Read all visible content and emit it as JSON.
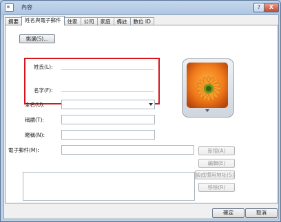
{
  "window": {
    "title": "內容",
    "help_label": "?",
    "close_label": "X"
  },
  "tabs": [
    "摘要",
    "姓名與電子郵件",
    "住家",
    "公司",
    "家庭",
    "備註",
    "數位 ID"
  ],
  "name_section": {
    "choose_button": "挑選(S)...",
    "last_name_label": "姓氏(L):",
    "first_name_label": "名字(F):",
    "full_name_label": "全名(U):",
    "title_label": "稱謂(T):",
    "nickname_label": "暱稱(N):"
  },
  "email_section": {
    "email_label": "電子郵件(M):",
    "add_button": "新增(A)",
    "edit_button": "編輯(E)",
    "set_default_button": "設成慣用地址(S)",
    "remove_button": "移除(R)"
  },
  "footer": {
    "ok_button": "確定",
    "cancel_button": "取消"
  },
  "photo": {
    "icon": "gerbera-flower-photo-icon",
    "menu_icon": "chevron-down-icon"
  },
  "colors": {
    "highlight_box": "#d6161c",
    "flower_orange": "#f07a1a",
    "flower_center": "#6f9a1a"
  }
}
